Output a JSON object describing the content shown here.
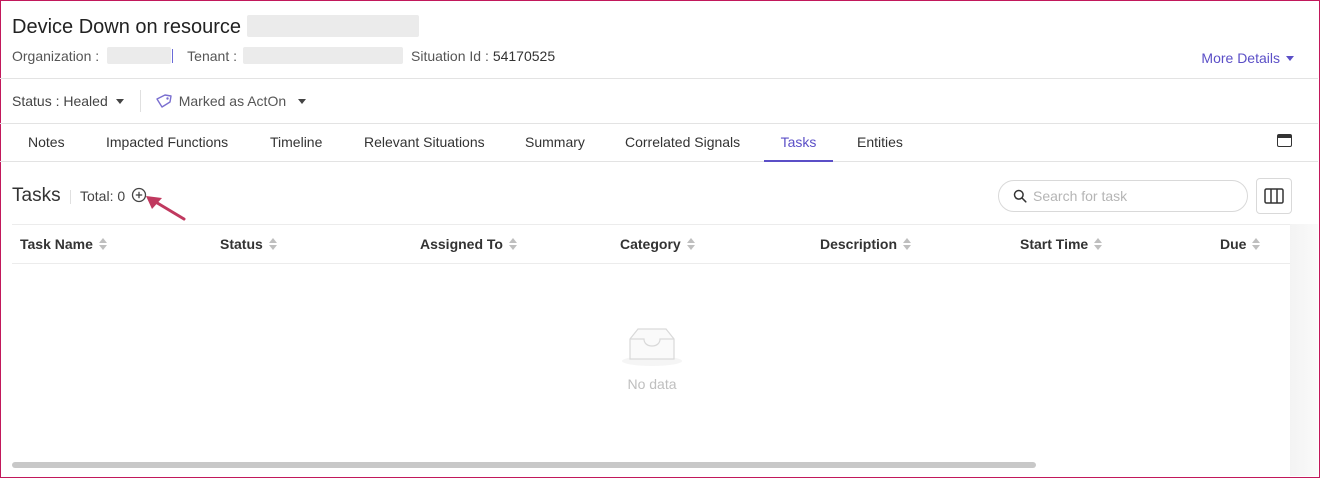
{
  "header": {
    "title": "Device Down on resource",
    "organization_label": "Organization :",
    "tenant_label": "Tenant :",
    "situation_label": "Situation Id :",
    "situation_id": "54170525",
    "more_details": "More Details"
  },
  "statusbar": {
    "status": "Status : Healed",
    "acton": "Marked as ActOn"
  },
  "tabs": [
    "Notes",
    "Impacted Functions",
    "Timeline",
    "Relevant Situations",
    "Summary",
    "Correlated Signals",
    "Tasks",
    "Entities"
  ],
  "active_tab": "Tasks",
  "tasks": {
    "title": "Tasks",
    "total": "Total: 0",
    "search_placeholder": "Search for task"
  },
  "table": {
    "columns": [
      "Task Name",
      "Status",
      "Assigned To",
      "Category",
      "Description",
      "Start Time",
      "Due"
    ],
    "empty_text": "No data"
  },
  "colors": {
    "accent": "#5b4fc7",
    "annotation_arrow": "#c0395f",
    "frame": "#c2185b"
  }
}
